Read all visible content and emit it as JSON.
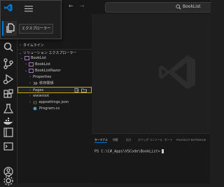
{
  "colors": {
    "accent": "#0078d4",
    "background": "#1f1f1f",
    "selection_border": "#cca700"
  },
  "titlebar": {
    "search_text": "BookList"
  },
  "popup": {
    "tooltip": "エクスプローラー"
  },
  "sidebar": {
    "sections": {
      "outline": "アウトライン",
      "timeline": "タイムライン",
      "solution": "ソリューション エクスプローラー"
    },
    "tree": [
      {
        "label": "BookList"
      },
      {
        "label": "BookList"
      },
      {
        "label": "BookListRazor"
      },
      {
        "label": "Properties"
      },
      {
        "label": "依存関係"
      },
      {
        "label": "Pages"
      },
      {
        "label": "wwwroot"
      },
      {
        "label": "appsettings.json"
      },
      {
        "label": "Program.cs"
      }
    ]
  },
  "panel": {
    "tabs": [
      "ターミナル",
      "問題",
      "出力",
      "デバッグ コンソール",
      "ポート",
      "POLYGLOT NOTEBOOK"
    ],
    "prompt": "PS C:\\C#_Apps\\VSCode\\BookList>"
  },
  "icons": [
    "vscode-logo-icon",
    "hamburger-menu-icon",
    "files-icon",
    "search-icon",
    "source-control-icon",
    "run-debug-icon",
    "extensions-icon",
    "testing-icon",
    "remote-icon",
    "docker-icon",
    "database-icon",
    "terminal-icon",
    "account-icon",
    "settings-icon"
  ]
}
